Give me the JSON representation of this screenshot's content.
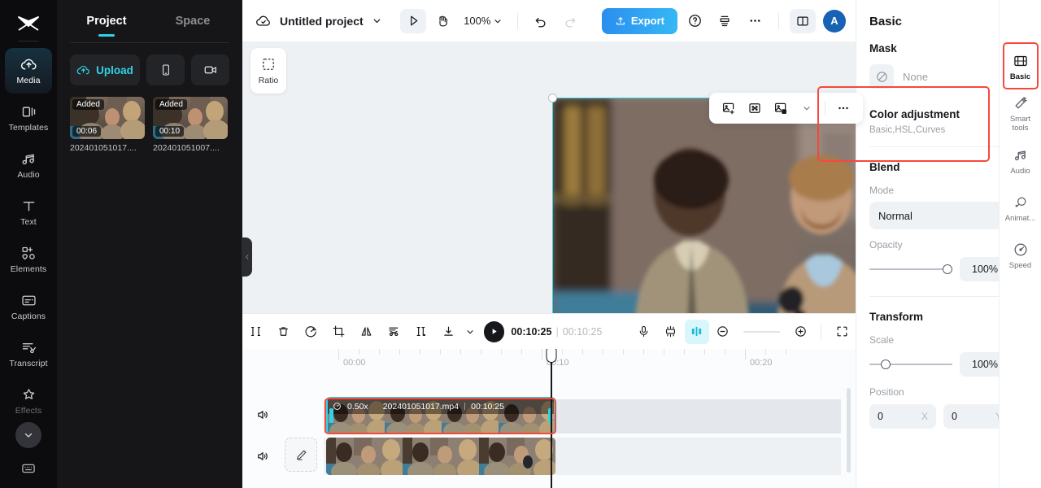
{
  "left_rail": {
    "logo_icon": "capcut-logo-icon",
    "items": [
      {
        "label": "Media",
        "icon": "cloud-upload-icon",
        "active": true
      },
      {
        "label": "Templates",
        "icon": "templates-icon",
        "active": false
      },
      {
        "label": "Audio",
        "icon": "music-note-icon",
        "active": false
      },
      {
        "label": "Text",
        "icon": "text-t-icon",
        "active": false
      },
      {
        "label": "Elements",
        "icon": "elements-icon",
        "active": false
      },
      {
        "label": "Captions",
        "icon": "captions-icon",
        "active": false
      },
      {
        "label": "Transcript",
        "icon": "transcript-icon",
        "active": false
      },
      {
        "label": "Effects",
        "icon": "sparkle-star-icon",
        "active": false
      }
    ],
    "more_icon": "chevron-down-icon",
    "bottom_icon": "keyboard-shortcuts-icon"
  },
  "media_panel": {
    "tabs": [
      {
        "label": "Project",
        "active": true
      },
      {
        "label": "Space",
        "active": false
      }
    ],
    "upload_label": "Upload",
    "upload_icon": "cloud-upload-icon",
    "device_icon": "phone-icon",
    "record_icon": "camera-record-icon",
    "items": [
      {
        "badge": "Added",
        "duration": "00:06",
        "name": "202401051017...."
      },
      {
        "badge": "Added",
        "duration": "00:10",
        "name": "202401051007...."
      }
    ],
    "collapse_icon": "chevron-left-icon"
  },
  "topbar": {
    "cloud_icon": "cloud-check-icon",
    "project_name": "Untitled project",
    "project_chevron_icon": "chevron-down-icon",
    "select_tool_icon": "cursor-arrow-icon",
    "hand_tool_icon": "hand-icon",
    "zoom_level": "100%",
    "zoom_chevron_icon": "chevron-down-icon",
    "undo_icon": "undo-icon",
    "redo_icon": "redo-icon",
    "export_label": "Export",
    "export_icon": "upload-box-icon",
    "help_icon": "question-circle-icon",
    "layers_icon": "stack-icon",
    "more_icon": "ellipsis-icon",
    "layout_icon": "split-layout-icon",
    "avatar_initial": "A"
  },
  "stage": {
    "ratio_label": "Ratio",
    "ratio_icon": "dashed-square-icon",
    "float_tools": [
      {
        "icon": "add-image-icon"
      },
      {
        "icon": "fit-to-frame-icon"
      },
      {
        "icon": "remove-background-icon"
      },
      {
        "icon": "chevron-down-icon"
      },
      {
        "icon": "ellipsis-icon"
      }
    ],
    "rotate_icon": "rotate-handle-icon"
  },
  "timeline_toolbar": {
    "buttons": [
      {
        "icon": "split-icon",
        "name": "split-button"
      },
      {
        "icon": "trash-icon",
        "name": "delete-button"
      },
      {
        "icon": "speed-icon",
        "name": "speed-button"
      },
      {
        "icon": "crop-icon",
        "name": "crop-button"
      },
      {
        "icon": "mirror-icon",
        "name": "mirror-button"
      },
      {
        "icon": "auto-cut-icon",
        "name": "auto-cut-button"
      },
      {
        "icon": "freeze-icon",
        "name": "freeze-button"
      },
      {
        "icon": "download-icon",
        "name": "download-button"
      },
      {
        "icon": "chevron-down-icon",
        "name": "download-chevron"
      }
    ],
    "play_icon": "play-icon",
    "current_time": "00:10:25",
    "separator": "|",
    "total_time": "00:10:25",
    "right_buttons": [
      {
        "icon": "microphone-icon",
        "name": "record-voice-button"
      },
      {
        "icon": "keyframe-strip-icon",
        "name": "markers-button"
      },
      {
        "icon": "magnet-snap-icon",
        "name": "snap-toggle",
        "highlight": true
      },
      {
        "icon": "zoom-out-icon",
        "name": "zoom-out-button"
      },
      {
        "icon": "zoom-in-icon",
        "name": "zoom-in-button"
      },
      {
        "icon": "fullscreen-icon",
        "name": "fit-timeline-button"
      }
    ]
  },
  "timeline": {
    "ruler_labels": [
      "00:00",
      "00:10",
      "00:20"
    ],
    "tracks": [
      {
        "speaker_icon": "speaker-icon",
        "clip": {
          "speed_icon": "speed-clock-icon",
          "speed": "0.50x",
          "filename": "202401051017.mp4",
          "duration": "00:10:25",
          "selected": true
        }
      },
      {
        "speaker_icon": "speaker-icon",
        "edit_icon": "pencil-edit-icon",
        "clip": {
          "selected": false
        }
      }
    ]
  },
  "properties": {
    "title": "Basic",
    "close_icon": "close-icon",
    "mask": {
      "title": "Mask",
      "value": "None",
      "icon": "none-circle-slash-icon",
      "chevron_icon": "chevron-right-icon"
    },
    "color_adjustment": {
      "title": "Color adjustment",
      "subtitle": "Basic,HSL,Curves",
      "chevron_icon": "chevron-right-icon"
    },
    "blend": {
      "title": "Blend",
      "reset_icon": "reset-icon",
      "mode_label": "Mode",
      "mode_value": "Normal",
      "mode_chevron_icon": "chevron-down-icon",
      "opacity_label": "Opacity",
      "opacity_value": "100%",
      "opacity_percent": 100,
      "keyframe_icon": "diamond-keyframe-icon"
    },
    "transform": {
      "title": "Transform",
      "reset_icon": "reset-icon",
      "scale_label": "Scale",
      "scale_value": "100%",
      "scale_percent": 15,
      "position_label": "Position",
      "position_x": "0",
      "position_x_axis": "X",
      "position_y": "0",
      "position_y_axis": "Y",
      "keyframe_icon": "diamond-keyframe-icon"
    },
    "rail": [
      {
        "label": "Basic",
        "icon": "film-strip-icon",
        "active": true
      },
      {
        "label": "Smart tools",
        "icon": "magic-wand-icon",
        "active": false
      },
      {
        "label": "Audio",
        "icon": "music-note-icon",
        "active": false
      },
      {
        "label": "Animat...",
        "icon": "animation-icon",
        "active": false
      },
      {
        "label": "Speed",
        "icon": "speedometer-icon",
        "active": false
      }
    ]
  },
  "annotations": {
    "accent_cyan": "#2fd4e8",
    "highlight_red": "#f7483b",
    "export_blue": "#2a8ef0"
  }
}
